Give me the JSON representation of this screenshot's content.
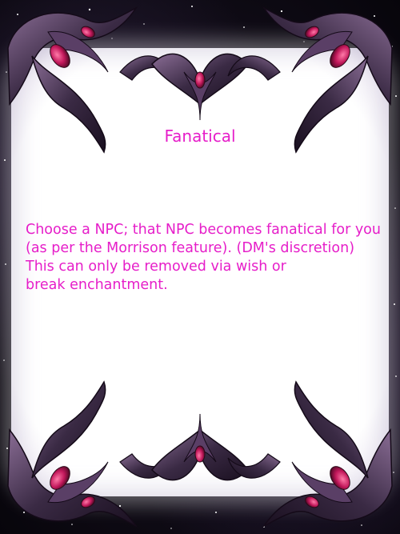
{
  "card": {
    "title": "Fanatical",
    "body_lines": [
      "Choose a NPC; that NPC becomes fanatical for you",
      "(as per the Morrison feature). (DM's discretion)",
      "This can only be removed via wish or",
      "break enchantment."
    ]
  },
  "colors": {
    "text": "#e61ec9",
    "frame_metal": "#3a2a44",
    "frame_gem": "#c2185b",
    "space_background": "#0b0810"
  },
  "icons": [
    "ornate-corner-icon",
    "gem-icon"
  ]
}
